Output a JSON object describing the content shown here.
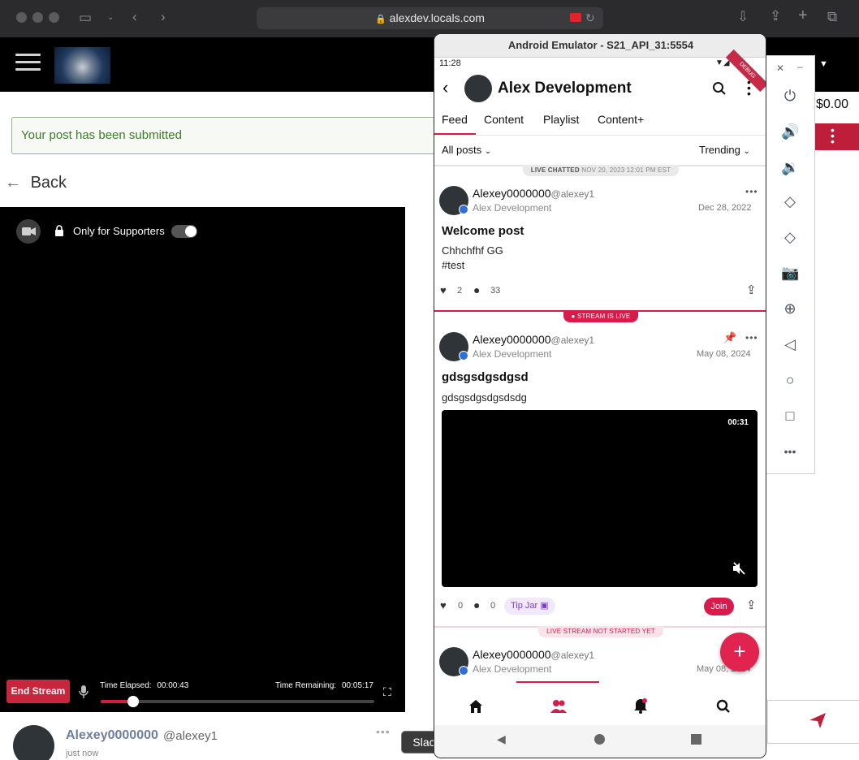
{
  "browser": {
    "url": "alexdev.locals.com"
  },
  "site": {
    "notice": "Your post has been submitted",
    "back_label": "Back",
    "supporters_label": "Only for Supporters",
    "end_stream_label": "End Stream",
    "time_elapsed_label": "Time Elapsed:",
    "time_elapsed_value": "00:00:43",
    "time_remaining_label": "Time Remaining:",
    "time_remaining_value": "00:05:17",
    "progress_fraction": 0.12,
    "price": "$0.00",
    "bottom_post": {
      "username": "Alexey0000000",
      "handle": "@alexey1",
      "time": "just now"
    },
    "tooltip": "Slack"
  },
  "emulator": {
    "title": "Android Emulator - S21_API_31:5554",
    "status_time": "11:28",
    "debug_label": "DEBUG",
    "app_title": "Alex Development",
    "tabs": [
      "Feed",
      "Content",
      "Playlist",
      "Content+"
    ],
    "filter_left": "All posts",
    "filter_right": "Trending",
    "live_chatted": {
      "label": "LIVE CHATTED",
      "date": "NOV 20, 2023 12:01 PM EST"
    },
    "post1": {
      "username": "Alexey0000000",
      "handle": "@alexey1",
      "channel": "Alex Development",
      "date": "Dec 28, 2022",
      "title": "Welcome post",
      "body_line1": "Chhchfhf GG",
      "body_line2": "#test",
      "likes": "2",
      "comments": "33"
    },
    "stream_live_label": "STREAM IS LIVE",
    "post2": {
      "username": "Alexey0000000",
      "handle": "@alexey1",
      "channel": "Alex Development",
      "date": "May 08, 2024",
      "title": "gdsgsdgsdgsd",
      "body": "gdsgsdgsdgsdsdg",
      "video_time": "00:31",
      "likes": "0",
      "comments": "0",
      "tip_jar": "Tip Jar",
      "join": "Join"
    },
    "not_started_label": "LIVE STREAM NOT STARTED YET",
    "post3": {
      "username": "Alexey0000000",
      "handle": "@alexey1",
      "channel": "Alex Development",
      "date": "May 08, 2024"
    },
    "fab": "+"
  },
  "colors": {
    "accent": "#d81b4a",
    "browser_chrome": "#2b2b2d",
    "site_header": "#000000",
    "notice_green": "#3d7a2a"
  },
  "icons": {
    "tools": [
      "power-icon",
      "volume-up-icon",
      "volume-down-icon",
      "rotate-left-icon",
      "rotate-right-icon",
      "camera-icon",
      "zoom-icon",
      "back-icon",
      "home-icon",
      "overview-icon",
      "more-icon"
    ]
  }
}
